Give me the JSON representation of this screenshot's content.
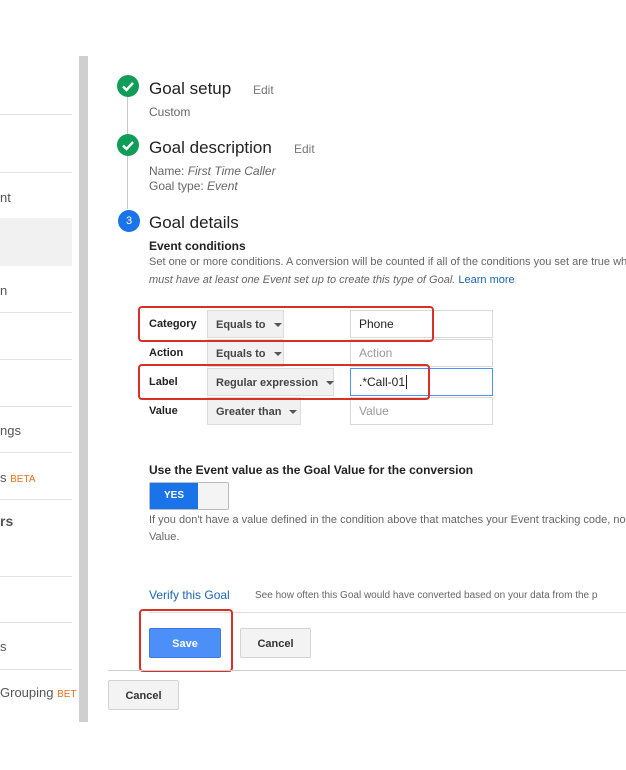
{
  "sidebar": {
    "items": [
      {
        "label": "nt"
      },
      {
        "label": "n"
      },
      {
        "label": "ngs"
      },
      {
        "label": "s",
        "badge": "BETA"
      },
      {
        "label": "rs"
      },
      {
        "label": "s"
      },
      {
        "label": "Grouping",
        "badge": "BET"
      }
    ]
  },
  "steps": {
    "setup": {
      "title": "Goal setup",
      "edit": "Edit",
      "value": "Custom"
    },
    "description": {
      "title": "Goal description",
      "edit": "Edit",
      "name_label": "Name:",
      "name_value": "First Time Caller",
      "type_label": "Goal type:",
      "type_value": "Event"
    },
    "details": {
      "number": "3",
      "title": "Goal details"
    }
  },
  "event_conditions": {
    "heading": "Event conditions",
    "description_line1": "Set one or more conditions. A conversion will be counted if all of the conditions you set are true wh",
    "description_line2": "must have at least one Event set up to create this type of Goal.",
    "learn_more": "Learn more",
    "rows": [
      {
        "label": "Category",
        "operator": "Equals to",
        "value": "Phone",
        "placeholder": ""
      },
      {
        "label": "Action",
        "operator": "Equals to",
        "value": "",
        "placeholder": "Action"
      },
      {
        "label": "Label",
        "operator": "Regular expression",
        "value": ".*Call-01",
        "placeholder": ""
      },
      {
        "label": "Value",
        "operator": "Greater than",
        "value": "",
        "placeholder": "Value"
      }
    ]
  },
  "goal_value": {
    "heading": "Use the Event value as the Goal Value for the conversion",
    "toggle_label": "YES",
    "note_line1": "If you don't have a value defined in the condition above that matches your Event tracking code, noth",
    "note_line2": "Value."
  },
  "verify": {
    "link": "Verify this Goal",
    "text": "See how often this Goal would have converted based on your data from the p"
  },
  "actions": {
    "save": "Save",
    "cancel": "Cancel",
    "outer_cancel": "Cancel"
  },
  "colors": {
    "check": "#0f9d58",
    "step": "#1a73e8",
    "primary": "#4d8ff8",
    "highlight": "#d93025",
    "beta": "#e8711c"
  }
}
